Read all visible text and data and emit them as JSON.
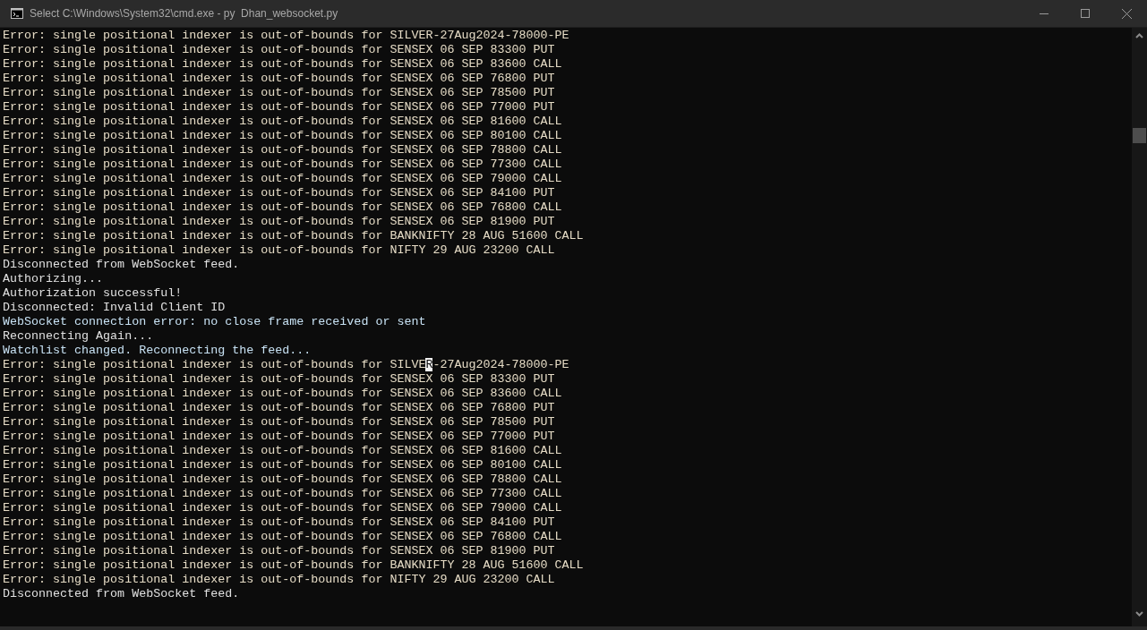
{
  "window": {
    "title": "Select C:\\Windows\\System32\\cmd.exe - py  Dhan_websocket.py"
  },
  "console": {
    "lines": [
      {
        "kind": "error",
        "text": "Error: single positional indexer is out-of-bounds for SILVER-27Aug2024-78000-PE"
      },
      {
        "kind": "error",
        "text": "Error: single positional indexer is out-of-bounds for SENSEX 06 SEP 83300 PUT"
      },
      {
        "kind": "error",
        "text": "Error: single positional indexer is out-of-bounds for SENSEX 06 SEP 83600 CALL"
      },
      {
        "kind": "error",
        "text": "Error: single positional indexer is out-of-bounds for SENSEX 06 SEP 76800 PUT"
      },
      {
        "kind": "error",
        "text": "Error: single positional indexer is out-of-bounds for SENSEX 06 SEP 78500 PUT"
      },
      {
        "kind": "error",
        "text": "Error: single positional indexer is out-of-bounds for SENSEX 06 SEP 77000 PUT"
      },
      {
        "kind": "error",
        "text": "Error: single positional indexer is out-of-bounds for SENSEX 06 SEP 81600 CALL"
      },
      {
        "kind": "error",
        "text": "Error: single positional indexer is out-of-bounds for SENSEX 06 SEP 80100 CALL"
      },
      {
        "kind": "error",
        "text": "Error: single positional indexer is out-of-bounds for SENSEX 06 SEP 78800 CALL"
      },
      {
        "kind": "error",
        "text": "Error: single positional indexer is out-of-bounds for SENSEX 06 SEP 77300 CALL"
      },
      {
        "kind": "error",
        "text": "Error: single positional indexer is out-of-bounds for SENSEX 06 SEP 79000 CALL"
      },
      {
        "kind": "error",
        "text": "Error: single positional indexer is out-of-bounds for SENSEX 06 SEP 84100 PUT"
      },
      {
        "kind": "error",
        "text": "Error: single positional indexer is out-of-bounds for SENSEX 06 SEP 76800 CALL"
      },
      {
        "kind": "error",
        "text": "Error: single positional indexer is out-of-bounds for SENSEX 06 SEP 81900 PUT"
      },
      {
        "kind": "error",
        "text": "Error: single positional indexer is out-of-bounds for BANKNIFTY 28 AUG 51600 CALL"
      },
      {
        "kind": "error",
        "text": "Error: single positional indexer is out-of-bounds for NIFTY 29 AUG 23200 CALL"
      },
      {
        "kind": "status",
        "text": "Disconnected from WebSocket feed."
      },
      {
        "kind": "status",
        "text": "Authorizing..."
      },
      {
        "kind": "status",
        "text": "Authorization successful!"
      },
      {
        "kind": "status",
        "text": "Disconnected: Invalid Client ID"
      },
      {
        "kind": "notice",
        "text": "WebSocket connection error: no close frame received or sent"
      },
      {
        "kind": "status",
        "text": "Reconnecting Again..."
      },
      {
        "kind": "notice",
        "text": "Watchlist changed. Reconnecting the feed..."
      },
      {
        "kind": "error",
        "text": "Error: single positional indexer is out-of-bounds for SILVE",
        "selected_text": "R",
        "text_after": "-27Aug2024-78000-PE"
      },
      {
        "kind": "error",
        "text": "Error: single positional indexer is out-of-bounds for SENSEX 06 SEP 83300 PUT"
      },
      {
        "kind": "error",
        "text": "Error: single positional indexer is out-of-bounds for SENSEX 06 SEP 83600 CALL"
      },
      {
        "kind": "error",
        "text": "Error: single positional indexer is out-of-bounds for SENSEX 06 SEP 76800 PUT"
      },
      {
        "kind": "error",
        "text": "Error: single positional indexer is out-of-bounds for SENSEX 06 SEP 78500 PUT"
      },
      {
        "kind": "error",
        "text": "Error: single positional indexer is out-of-bounds for SENSEX 06 SEP 77000 PUT"
      },
      {
        "kind": "error",
        "text": "Error: single positional indexer is out-of-bounds for SENSEX 06 SEP 81600 CALL"
      },
      {
        "kind": "error",
        "text": "Error: single positional indexer is out-of-bounds for SENSEX 06 SEP 80100 CALL"
      },
      {
        "kind": "error",
        "text": "Error: single positional indexer is out-of-bounds for SENSEX 06 SEP 78800 CALL"
      },
      {
        "kind": "error",
        "text": "Error: single positional indexer is out-of-bounds for SENSEX 06 SEP 77300 CALL"
      },
      {
        "kind": "error",
        "text": "Error: single positional indexer is out-of-bounds for SENSEX 06 SEP 79000 CALL"
      },
      {
        "kind": "error",
        "text": "Error: single positional indexer is out-of-bounds for SENSEX 06 SEP 84100 PUT"
      },
      {
        "kind": "error",
        "text": "Error: single positional indexer is out-of-bounds for SENSEX 06 SEP 76800 CALL"
      },
      {
        "kind": "error",
        "text": "Error: single positional indexer is out-of-bounds for SENSEX 06 SEP 81900 PUT"
      },
      {
        "kind": "error",
        "text": "Error: single positional indexer is out-of-bounds for BANKNIFTY 28 AUG 51600 CALL"
      },
      {
        "kind": "error",
        "text": "Error: single positional indexer is out-of-bounds for NIFTY 29 AUG 23200 CALL"
      },
      {
        "kind": "status",
        "text": "Disconnected from WebSocket feed."
      }
    ]
  }
}
